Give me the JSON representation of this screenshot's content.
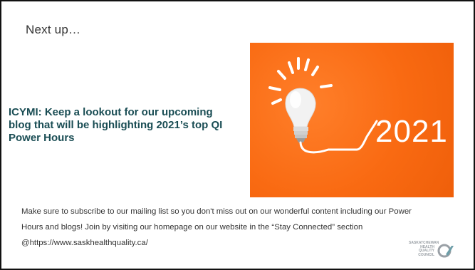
{
  "slide": {
    "title": "Next up…",
    "headline": "ICYMI: Keep a lookout for our upcoming blog that will be highlighting 2021’s top QI Power Hours",
    "body": "Make sure to subscribe to our mailing list so you don't miss out on our wonderful content including our Power Hours and blogs! Join by visiting our homepage on our website in the “Stay Connected” section @https://www.saskhealthquality.ca/"
  },
  "photo": {
    "year": "2021",
    "background_color": "#f96a12",
    "icon": "lightbulb-icon"
  },
  "logo": {
    "text": "SASKATCHEWAN HEALTH QUALITY COUNCIL",
    "icon": "hqc-logo-icon"
  },
  "colors": {
    "headline": "#1a4d54",
    "text": "#333333",
    "border": "#111111"
  }
}
